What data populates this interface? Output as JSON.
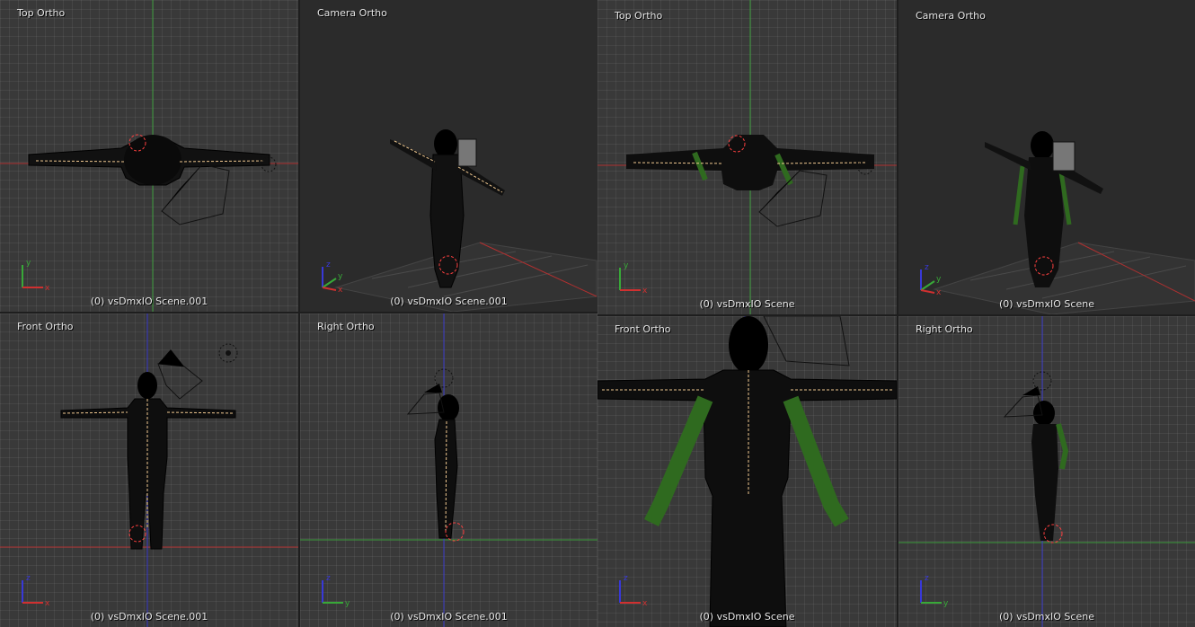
{
  "panels": [
    {
      "name": "left",
      "viewports": [
        {
          "id": "top",
          "label": "Top Ortho",
          "footer": "(0) vsDmxIO Scene.001",
          "axes": [
            "x",
            "y"
          ]
        },
        {
          "id": "camera",
          "label": "Camera Ortho",
          "footer": "(0) vsDmxIO Scene.001",
          "axes": [
            "x",
            "y",
            "z"
          ]
        },
        {
          "id": "front",
          "label": "Front Ortho",
          "footer": "(0) vsDmxIO Scene.001",
          "axes": [
            "x",
            "z"
          ]
        },
        {
          "id": "right",
          "label": "Right Ortho",
          "footer": "(0) vsDmxIO Scene.001",
          "axes": [
            "y",
            "z"
          ]
        }
      ]
    },
    {
      "name": "right",
      "viewports": [
        {
          "id": "top",
          "label": "Top Ortho",
          "footer": "(0) vsDmxIO Scene",
          "axes": [
            "x",
            "y"
          ]
        },
        {
          "id": "camera",
          "label": "Camera Ortho",
          "footer": "(0) vsDmxIO Scene",
          "axes": [
            "x",
            "y",
            "z"
          ]
        },
        {
          "id": "front",
          "label": "Front Ortho",
          "footer": "(0) vsDmxIO Scene",
          "axes": [
            "x",
            "z"
          ]
        },
        {
          "id": "right",
          "label": "Right Ortho",
          "footer": "(0) vsDmxIO Scene",
          "axes": [
            "y",
            "z"
          ]
        }
      ]
    }
  ],
  "colors": {
    "background": "#393939",
    "camera_background": "#2b2b2b",
    "axis_x": "#d03030",
    "axis_y": "#38a838",
    "axis_z": "#3838d8",
    "mesh": "#000000",
    "bones": "#f0c890",
    "cursor": "#ff3030",
    "clothing_wire": "#2f6a1f"
  }
}
